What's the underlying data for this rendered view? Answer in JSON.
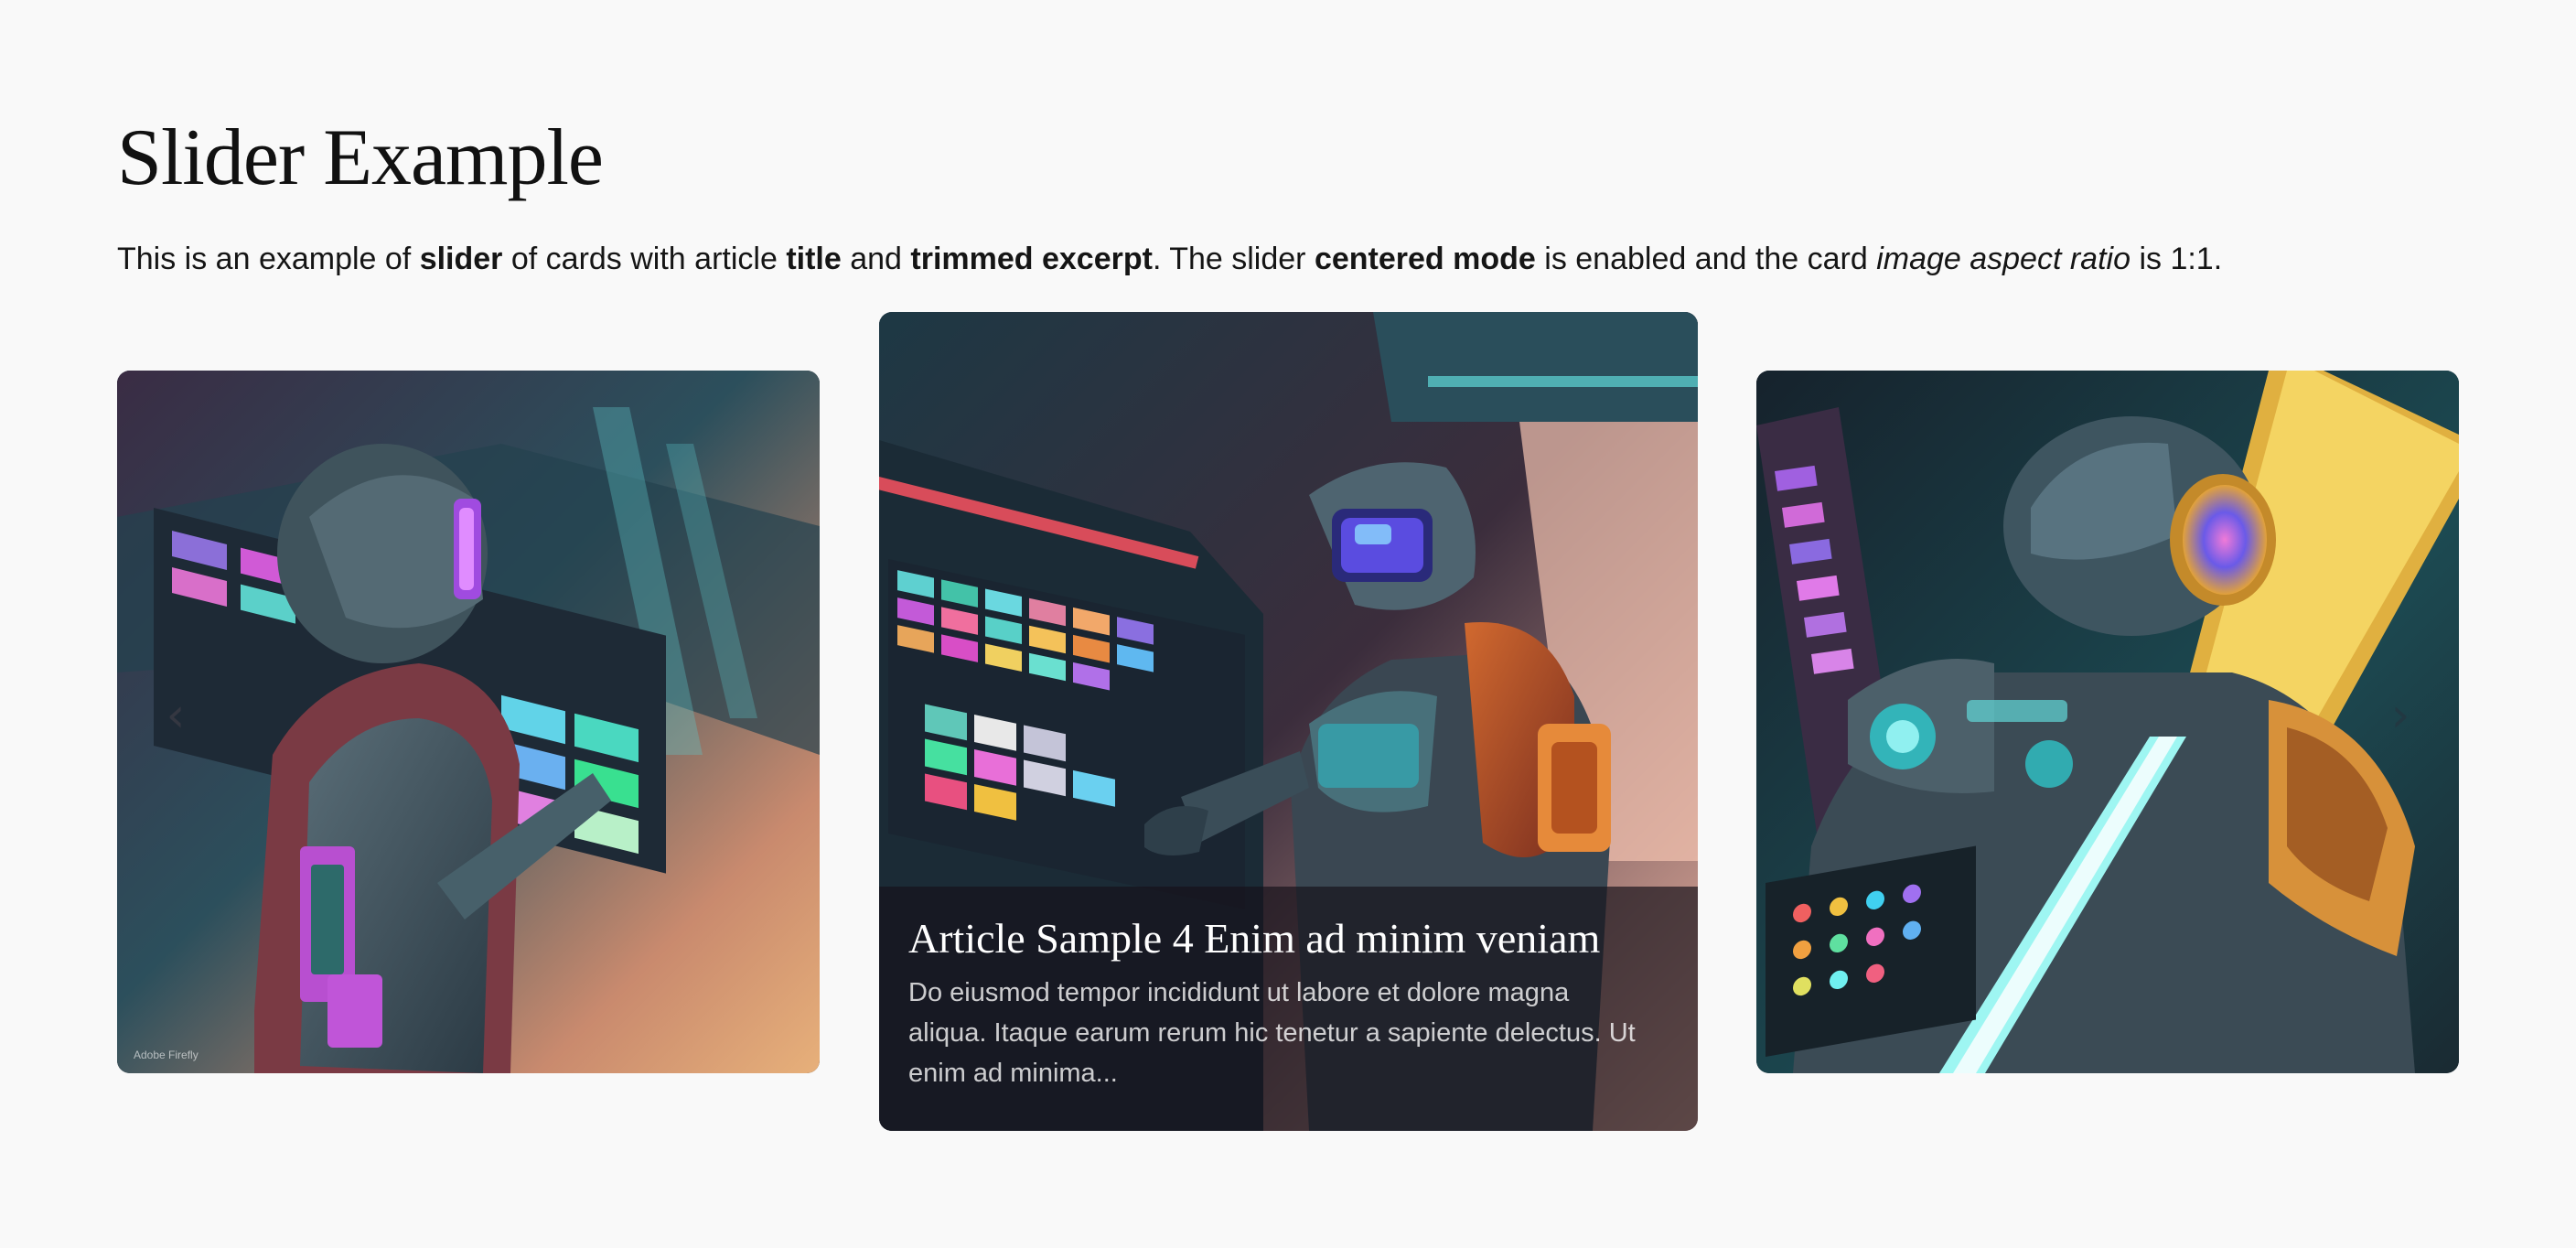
{
  "page": {
    "title": "Slider Example",
    "intro": {
      "t1": "This is an example of ",
      "b1": "slider",
      "t2": " of cards with article ",
      "b2": "title",
      "t3": " and ",
      "b3": "trimmed excerpt",
      "t4": ". The slider ",
      "b4": "centered mode",
      "t5": " is enabled and the card ",
      "i1": "image aspect ratio",
      "t6": " is 1:1."
    }
  },
  "slider": {
    "prev_icon": "chevron-left-icon",
    "next_icon": "chevron-right-icon",
    "prev_glyph": "‹",
    "next_glyph": "›",
    "cards": [
      {
        "position": "left",
        "image": "cyberpunk-astronaut-holding-keyboard-illustration"
      },
      {
        "position": "center",
        "image": "cyberpunk-astronaut-at-control-panel-illustration",
        "title": "Article Sample 4 Enim ad minim veniam",
        "excerpt": "Do eiusmod tempor incididunt ut labore et dolore magna aliqua. Itaque earum rerum hic tenetur a sapiente delectus. Ut enim ad minima..."
      },
      {
        "position": "right",
        "image": "cyberpunk-robot-with-neon-visor-illustration"
      }
    ]
  },
  "colors": {
    "background": "#f9f9f9",
    "text": "#151515",
    "teal": "#2fc3c7",
    "magenta": "#d13fd1",
    "orange": "#e9823a",
    "dark": "#1b2330"
  }
}
